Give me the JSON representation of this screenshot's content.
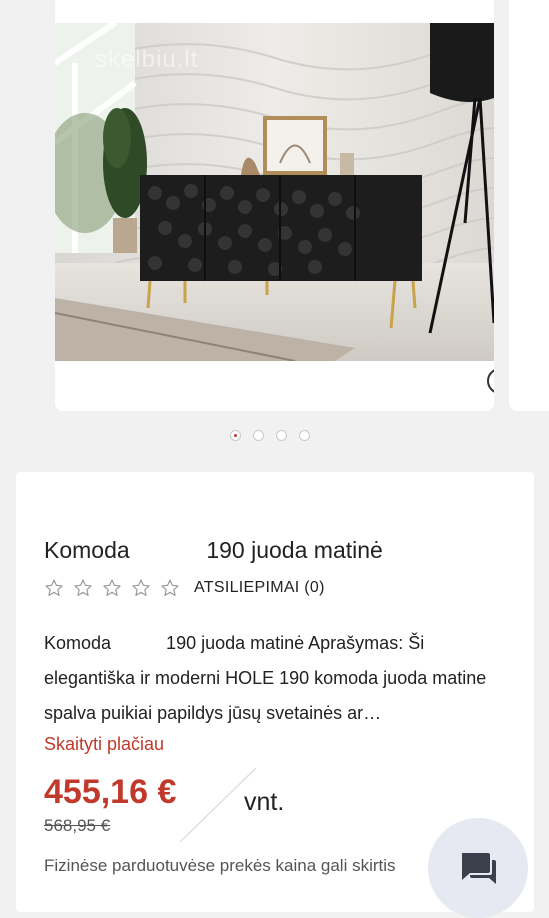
{
  "gallery": {
    "watermark": "skelbiu.lt",
    "image_alt": "Black textured sideboard with gold legs in a white room",
    "dots": [
      {
        "active": true
      },
      {
        "active": false
      },
      {
        "active": false
      },
      {
        "active": false
      }
    ]
  },
  "product": {
    "title": "Komoda            190 juoda matinė",
    "rating": {
      "stars": 5,
      "filled": 0
    },
    "reviews_label": "ATSILIEPIMAI (0)",
    "description": "Komoda           190 juoda matinė Aprašymas: Ši elegantiška ir moderni HOLE 190 komoda juoda matine spalva puikiai papildys jūsų svetainės ar…",
    "read_more": "Skaityti plačiau",
    "price": "455,16 €",
    "old_price": "568,95 €",
    "unit": "vnt.",
    "notice": "Fizinėse parduotuvėse prekės kaina gali skirtis"
  },
  "colors": {
    "accent": "#c0392b",
    "chat_bg": "#e6e9f1"
  }
}
